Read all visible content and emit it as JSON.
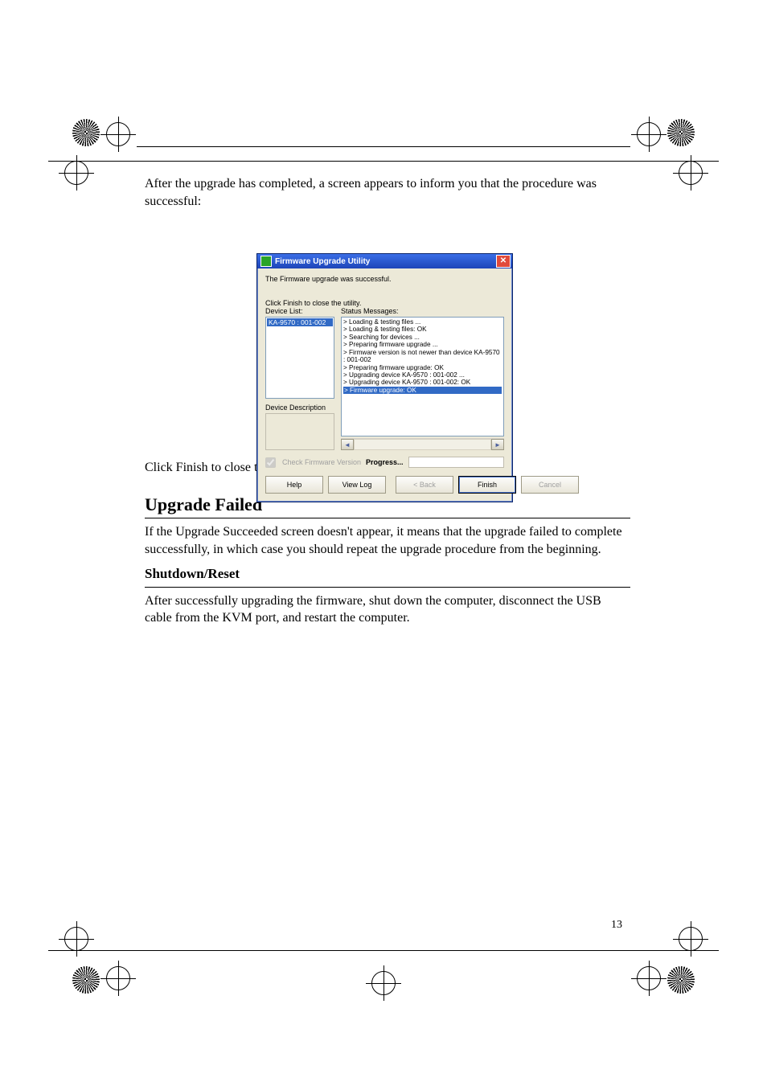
{
  "header": "",
  "copy": {
    "intro": "After the upgrade has completed, a screen appears to inform you that the procedure was successful:",
    "after_dialog": "Click Finish to close the Firmware Upgrade Utility.",
    "h1": "Upgrade Failed",
    "sub": "Shutdown/Reset",
    "p1": "If the Upgrade Succeeded screen doesn't appear, it means that the upgrade failed to complete successfully, in which case you should repeat the upgrade procedure from the beginning.",
    "p2": "After successfully upgrading the firmware, shut down the computer, disconnect the USB cable from the KVM port, and restart the computer."
  },
  "page_number": "13",
  "dialog": {
    "title": "Firmware Upgrade Utility",
    "success_msg": "The Firmware upgrade was successful.",
    "instruction": "Click Finish to close the utility.",
    "device_list_label": "Device List:",
    "status_label": "Status Messages:",
    "device_selected": "KA-9570 : 001-002",
    "status_lines": [
      "> Loading & testing files ...",
      "> Loading & testing files: OK",
      "> Searching for devices ...",
      "> Preparing firmware upgrade ...",
      "> Firmware version is not newer than device KA-9570 : 001-002",
      "> Preparing firmware upgrade: OK",
      "> Upgrading device KA-9570 : 001-002 ...",
      "> Upgrading device KA-9570 : 001-002: OK"
    ],
    "status_last": "> Firmware upgrade: OK",
    "device_desc_label": "Device Description",
    "check_fw_label": "Check Firmware Version",
    "progress_label": "Progress...",
    "btn_help": "Help",
    "btn_viewlog": "View Log",
    "btn_back": "< Back",
    "btn_finish": "Finish",
    "btn_cancel": "Cancel"
  }
}
